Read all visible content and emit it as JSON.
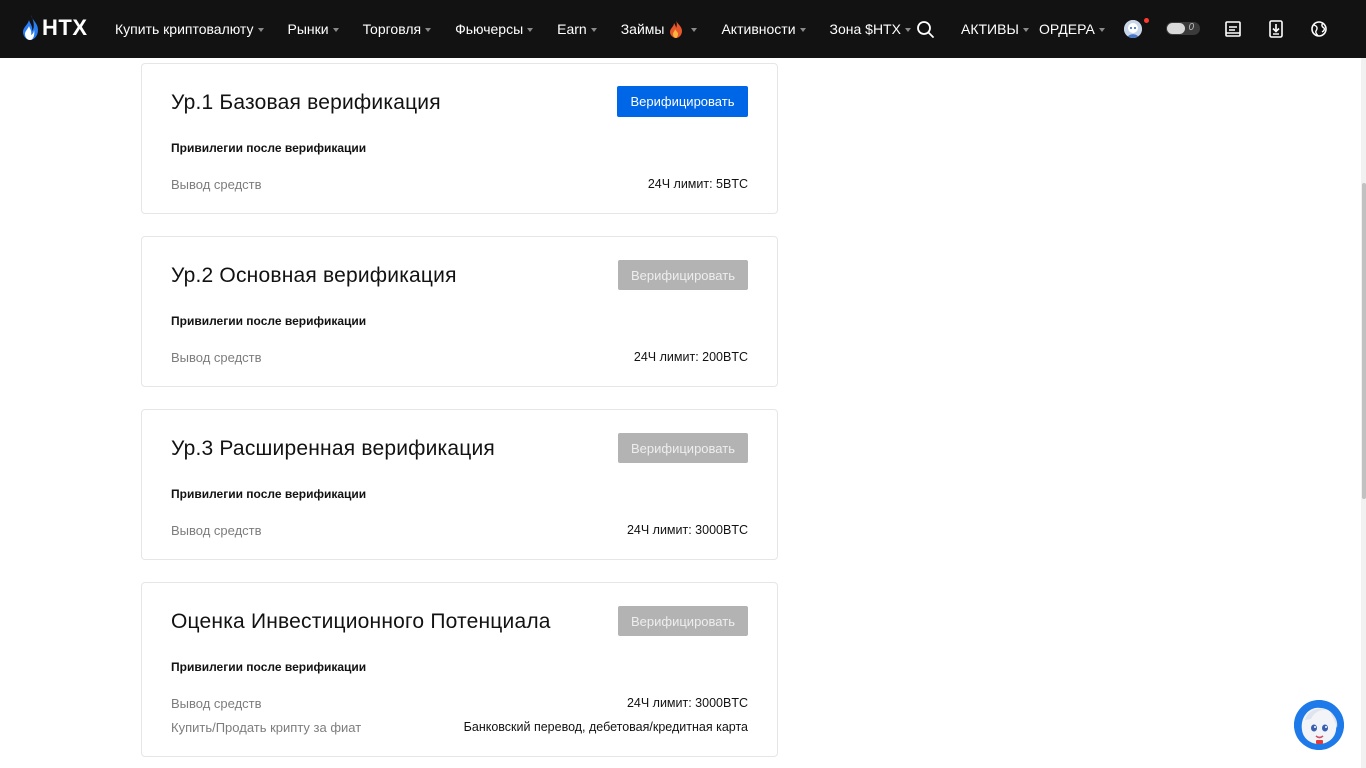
{
  "navbar": {
    "logo_text": "HTX",
    "menu": [
      {
        "label": "Купить криптовалюту",
        "caret": true
      },
      {
        "label": "Рынки",
        "caret": true
      },
      {
        "label": "Торговля",
        "caret": true
      },
      {
        "label": "Фьючерсы",
        "caret": true
      },
      {
        "label": "Earn",
        "caret": true
      },
      {
        "label": "Займы",
        "caret": true,
        "icon": "flame-icon"
      },
      {
        "label": "Активности",
        "caret": true
      },
      {
        "label": "Зона $HTX",
        "caret": true
      }
    ],
    "assets_label": "АКТИВЫ",
    "orders_label": "ОРДЕРА",
    "toggle_value": "0",
    "icons": [
      "search-icon",
      "avatar",
      "notification-dot",
      "toggle",
      "orders-doc-icon",
      "download-icon",
      "language-globe-icon"
    ]
  },
  "cards": [
    {
      "title": "Ур.1 Базовая верификация",
      "button": "Верифицировать",
      "button_state": "active",
      "privileges_label": "Привилегии после верификации",
      "rows": [
        {
          "key": "Вывод средств",
          "value": "24Ч лимит: 5BTC"
        }
      ]
    },
    {
      "title": "Ур.2 Основная верификация",
      "button": "Верифицировать",
      "button_state": "disabled",
      "privileges_label": "Привилегии после верификации",
      "rows": [
        {
          "key": "Вывод средств",
          "value": "24Ч лимит: 200BTC"
        }
      ]
    },
    {
      "title": "Ур.3 Расширенная верификация",
      "button": "Верифицировать",
      "button_state": "disabled",
      "privileges_label": "Привилегии после верификации",
      "rows": [
        {
          "key": "Вывод средств",
          "value": "24Ч лимит: 3000BTC"
        }
      ]
    },
    {
      "title": "Оценка Инвестиционного Потенциала",
      "button": "Верифицировать",
      "button_state": "disabled",
      "privileges_label": "Привилегии после верификации",
      "rows": [
        {
          "key": "Вывод средств",
          "value": "24Ч лимит: 3000BTC"
        },
        {
          "key": "Купить/Продать крипту за фиат",
          "value": "Банковский перевод, дебетовая/кредитная карта"
        }
      ]
    }
  ],
  "colors": {
    "navbar_bg": "#121212",
    "primary_blue": "#0066e8",
    "disabled_gray": "#b3b3b3",
    "muted_text": "#7d7d7d",
    "card_border": "#e6e6e6"
  }
}
